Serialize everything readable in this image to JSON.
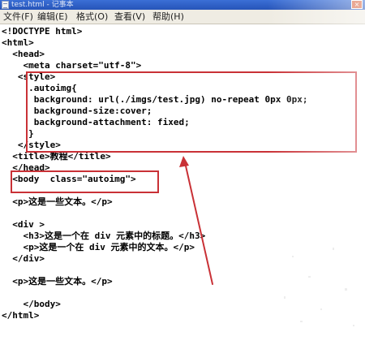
{
  "window": {
    "title": "test.html - 记事本",
    "close_glyph": "×"
  },
  "menubar": {
    "items": [
      {
        "label": "文件(F)"
      },
      {
        "label": "编辑(E)"
      },
      {
        "label": "格式(O)"
      },
      {
        "label": "查看(V)"
      },
      {
        "label": "帮助(H)"
      }
    ]
  },
  "editor": {
    "lines": [
      "<!DOCTYPE html>",
      "<html>",
      "  <head>",
      "    <meta charset=\"utf-8\">",
      "   <style>",
      "     .autoimg{",
      "      background: url(./imgs/test.jpg) no-repeat 0px 0px;",
      "      background-size:cover;",
      "      background-attachment: fixed;",
      "     }",
      "   </style>",
      "  <title>教程</title>",
      "  </head>",
      "  <body  class=\"autoimg\">",
      "",
      "  <p>这是一些文本。</p>",
      "",
      "  <div >",
      "    <h3>这是一个在 div 元素中的标题。</h3>",
      "    <p>这是一个在 div 元素中的文本。</p>",
      "  </div>",
      "",
      "  <p>这是一些文本。</p>",
      "",
      "    </body>",
      "</html>"
    ]
  },
  "annotations": {
    "highlight_color": "#c93136"
  }
}
